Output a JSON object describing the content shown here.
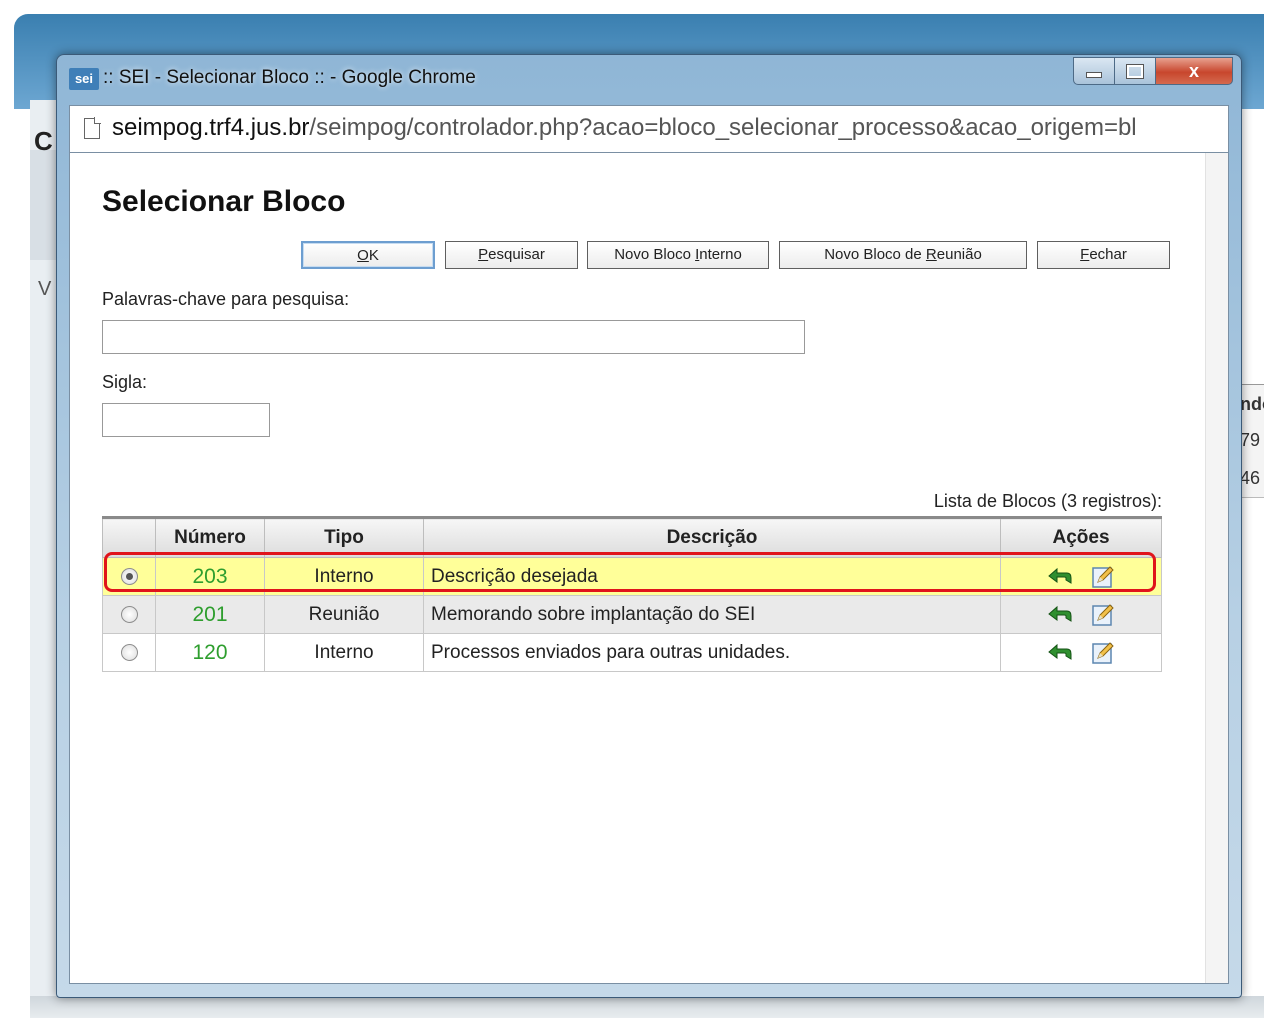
{
  "background": {
    "left_letters": [
      "C",
      "V"
    ],
    "right_fragments": [
      "ndo",
      "79",
      "46"
    ]
  },
  "window": {
    "logo": "sei",
    "title": ":: SEI - Selecionar Bloco :: - Google Chrome",
    "controls": {
      "minimize": "",
      "maximize": "",
      "close": "x"
    }
  },
  "address": {
    "host": "seimpog.trf4.jus.br",
    "path": "/seimpog/controlador.php?acao=bloco_selecionar_processo&acao_origem=bl"
  },
  "page": {
    "title": "Selecionar Bloco",
    "buttons": {
      "ok": {
        "accesskey": "O",
        "rest": "K"
      },
      "pesquisar": {
        "accesskey": "P",
        "rest": "esquisar"
      },
      "novo_interno": {
        "before": "Novo Bloco ",
        "accesskey": "I",
        "after": "nterno"
      },
      "novo_reuniao": {
        "before": "Novo Bloco de ",
        "accesskey": "R",
        "after": "eunião"
      },
      "fechar": {
        "accesskey": "F",
        "rest": "echar"
      }
    },
    "keywords_label": "Palavras-chave para pesquisa:",
    "keywords_value": "",
    "sigla_label": "Sigla:",
    "sigla_value": "",
    "list_caption": "Lista de Blocos (3 registros):"
  },
  "table": {
    "headers": {
      "radio": "",
      "numero": "Número",
      "tipo": "Tipo",
      "descricao": "Descrição",
      "acoes": "Ações"
    },
    "rows": [
      {
        "numero": "203",
        "tipo": "Interno",
        "descricao": "Descrição desejada",
        "selected": true
      },
      {
        "numero": "201",
        "tipo": "Reunião",
        "descricao": "Memorando sobre implantação do SEI",
        "selected": false
      },
      {
        "numero": "120",
        "tipo": "Interno",
        "descricao": "Processos enviados para outras unidades.",
        "selected": false
      }
    ]
  },
  "icons": {
    "select_action": "return-arrow-icon",
    "edit_action": "edit-pencil-icon"
  },
  "colors": {
    "highlight": "#e0141b",
    "selected_row": "#ffff99",
    "number_link": "#2e9e2e"
  }
}
